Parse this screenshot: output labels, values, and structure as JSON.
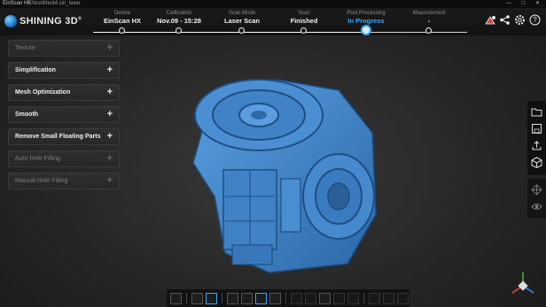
{
  "titlebar": {
    "app_name": "EinScan HX",
    "path": "E:/test4/test4.sin_laser",
    "window_controls": "— □ ✕"
  },
  "logo": {
    "text": "SHINING 3D",
    "mark": "®"
  },
  "steps": [
    {
      "label": "Device",
      "value": "EinScan HX",
      "active": false
    },
    {
      "label": "Calibration",
      "value": "Nov.09 - 15:28",
      "active": false
    },
    {
      "label": "Scan Mode",
      "value": "Laser Scan",
      "active": false
    },
    {
      "label": "Scan",
      "value": "Finished",
      "active": false
    },
    {
      "label": "Post Processing",
      "value": "In Progress",
      "active": true
    },
    {
      "label": "Measurement",
      "value": "-",
      "active": false
    }
  ],
  "top_icons": [
    "mesh-view-icon",
    "share-icon",
    "settings-icon",
    "help-icon"
  ],
  "left_panel": [
    {
      "label": "Texture",
      "enabled": false
    },
    {
      "label": "Simplification",
      "enabled": true
    },
    {
      "label": "Mesh Optimization",
      "enabled": true
    },
    {
      "label": "Smooth",
      "enabled": true
    },
    {
      "label": "Remove Small Floating Parts",
      "enabled": true
    },
    {
      "label": "Auto Hole Filling",
      "enabled": false
    },
    {
      "label": "Manual Hole Filling",
      "enabled": false
    }
  ],
  "right_tools": [
    "folder-icon",
    "save-icon",
    "export-icon",
    "cube-view-icon"
  ],
  "right_tools2": [
    "mesh-toggle-icon",
    "eye-icon"
  ],
  "bottom_tools": [
    "fit-view-icon",
    "layers-icon",
    "texture-icon",
    "rect-select-icon",
    "lasso-select-icon",
    "brush-select-icon",
    "erase-icon",
    "invert-select-icon",
    "unselect-icon",
    "clear-select-icon",
    "delete-icon",
    "undo-icon",
    "apply-icon",
    "cancel-icon"
  ],
  "colors": {
    "accent": "#3aa8ff",
    "model": "#3d82c8"
  }
}
